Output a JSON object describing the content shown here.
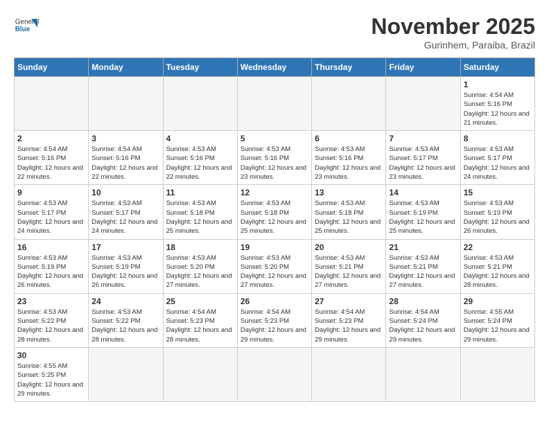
{
  "header": {
    "logo_general": "General",
    "logo_blue": "Blue",
    "title": "November 2025",
    "location": "Gurinhem, Paraiba, Brazil"
  },
  "weekdays": [
    "Sunday",
    "Monday",
    "Tuesday",
    "Wednesday",
    "Thursday",
    "Friday",
    "Saturday"
  ],
  "weeks": [
    [
      {
        "day": "",
        "info": ""
      },
      {
        "day": "",
        "info": ""
      },
      {
        "day": "",
        "info": ""
      },
      {
        "day": "",
        "info": ""
      },
      {
        "day": "",
        "info": ""
      },
      {
        "day": "",
        "info": ""
      },
      {
        "day": "1",
        "info": "Sunrise: 4:54 AM\nSunset: 5:16 PM\nDaylight: 12 hours and 21 minutes."
      }
    ],
    [
      {
        "day": "2",
        "info": "Sunrise: 4:54 AM\nSunset: 5:16 PM\nDaylight: 12 hours and 22 minutes."
      },
      {
        "day": "3",
        "info": "Sunrise: 4:54 AM\nSunset: 5:16 PM\nDaylight: 12 hours and 22 minutes."
      },
      {
        "day": "4",
        "info": "Sunrise: 4:53 AM\nSunset: 5:16 PM\nDaylight: 12 hours and 22 minutes."
      },
      {
        "day": "5",
        "info": "Sunrise: 4:53 AM\nSunset: 5:16 PM\nDaylight: 12 hours and 23 minutes."
      },
      {
        "day": "6",
        "info": "Sunrise: 4:53 AM\nSunset: 5:16 PM\nDaylight: 12 hours and 23 minutes."
      },
      {
        "day": "7",
        "info": "Sunrise: 4:53 AM\nSunset: 5:17 PM\nDaylight: 12 hours and 23 minutes."
      },
      {
        "day": "8",
        "info": "Sunrise: 4:53 AM\nSunset: 5:17 PM\nDaylight: 12 hours and 24 minutes."
      }
    ],
    [
      {
        "day": "9",
        "info": "Sunrise: 4:53 AM\nSunset: 5:17 PM\nDaylight: 12 hours and 24 minutes."
      },
      {
        "day": "10",
        "info": "Sunrise: 4:53 AM\nSunset: 5:17 PM\nDaylight: 12 hours and 24 minutes."
      },
      {
        "day": "11",
        "info": "Sunrise: 4:53 AM\nSunset: 5:18 PM\nDaylight: 12 hours and 25 minutes."
      },
      {
        "day": "12",
        "info": "Sunrise: 4:53 AM\nSunset: 5:18 PM\nDaylight: 12 hours and 25 minutes."
      },
      {
        "day": "13",
        "info": "Sunrise: 4:53 AM\nSunset: 5:18 PM\nDaylight: 12 hours and 25 minutes."
      },
      {
        "day": "14",
        "info": "Sunrise: 4:53 AM\nSunset: 5:19 PM\nDaylight: 12 hours and 25 minutes."
      },
      {
        "day": "15",
        "info": "Sunrise: 4:53 AM\nSunset: 5:19 PM\nDaylight: 12 hours and 26 minutes."
      }
    ],
    [
      {
        "day": "16",
        "info": "Sunrise: 4:53 AM\nSunset: 5:19 PM\nDaylight: 12 hours and 26 minutes."
      },
      {
        "day": "17",
        "info": "Sunrise: 4:53 AM\nSunset: 5:19 PM\nDaylight: 12 hours and 26 minutes."
      },
      {
        "day": "18",
        "info": "Sunrise: 4:53 AM\nSunset: 5:20 PM\nDaylight: 12 hours and 27 minutes."
      },
      {
        "day": "19",
        "info": "Sunrise: 4:53 AM\nSunset: 5:20 PM\nDaylight: 12 hours and 27 minutes."
      },
      {
        "day": "20",
        "info": "Sunrise: 4:53 AM\nSunset: 5:21 PM\nDaylight: 12 hours and 27 minutes."
      },
      {
        "day": "21",
        "info": "Sunrise: 4:53 AM\nSunset: 5:21 PM\nDaylight: 12 hours and 27 minutes."
      },
      {
        "day": "22",
        "info": "Sunrise: 4:53 AM\nSunset: 5:21 PM\nDaylight: 12 hours and 28 minutes."
      }
    ],
    [
      {
        "day": "23",
        "info": "Sunrise: 4:53 AM\nSunset: 5:22 PM\nDaylight: 12 hours and 28 minutes."
      },
      {
        "day": "24",
        "info": "Sunrise: 4:53 AM\nSunset: 5:22 PM\nDaylight: 12 hours and 28 minutes."
      },
      {
        "day": "25",
        "info": "Sunrise: 4:54 AM\nSunset: 5:23 PM\nDaylight: 12 hours and 28 minutes."
      },
      {
        "day": "26",
        "info": "Sunrise: 4:54 AM\nSunset: 5:23 PM\nDaylight: 12 hours and 29 minutes."
      },
      {
        "day": "27",
        "info": "Sunrise: 4:54 AM\nSunset: 5:23 PM\nDaylight: 12 hours and 29 minutes."
      },
      {
        "day": "28",
        "info": "Sunrise: 4:54 AM\nSunset: 5:24 PM\nDaylight: 12 hours and 29 minutes."
      },
      {
        "day": "29",
        "info": "Sunrise: 4:55 AM\nSunset: 5:24 PM\nDaylight: 12 hours and 29 minutes."
      }
    ],
    [
      {
        "day": "30",
        "info": "Sunrise: 4:55 AM\nSunset: 5:25 PM\nDaylight: 12 hours and 29 minutes."
      },
      {
        "day": "",
        "info": ""
      },
      {
        "day": "",
        "info": ""
      },
      {
        "day": "",
        "info": ""
      },
      {
        "day": "",
        "info": ""
      },
      {
        "day": "",
        "info": ""
      },
      {
        "day": "",
        "info": ""
      }
    ]
  ]
}
